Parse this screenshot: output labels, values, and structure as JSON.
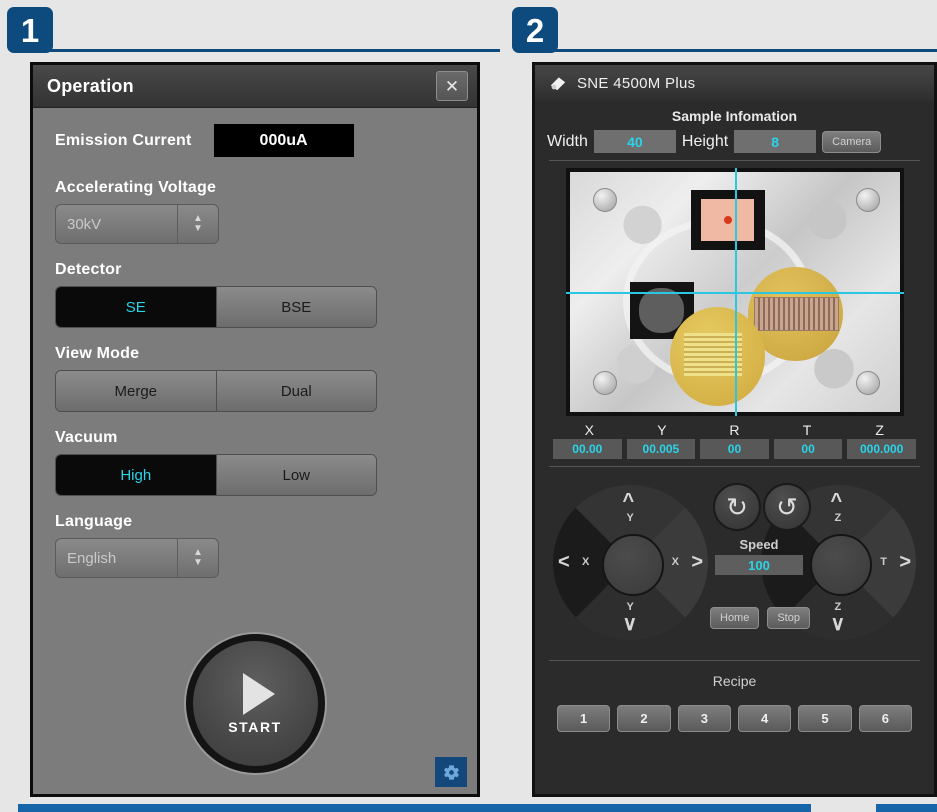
{
  "badges": {
    "one": "1",
    "two": "2"
  },
  "panel1": {
    "title": "Operation",
    "close_icon": "close-icon",
    "emission": {
      "label": "Emission Current",
      "value": "000uA"
    },
    "accelerating": {
      "label": "Accelerating Voltage",
      "value": "30kV"
    },
    "detector": {
      "label": "Detector",
      "options": [
        "SE",
        "BSE"
      ],
      "selected": "SE"
    },
    "view_mode": {
      "label": "View Mode",
      "options": [
        "Merge",
        "Dual"
      ],
      "selected": ""
    },
    "vacuum": {
      "label": "Vacuum",
      "options": [
        "High",
        "Low"
      ],
      "selected": "High"
    },
    "language": {
      "label": "Language",
      "value": "English"
    },
    "start": {
      "label": "START",
      "icon": "play-icon"
    },
    "settings": {
      "icon": "gear-icon"
    },
    "accent_cyan": "#2ad4e8"
  },
  "panel2": {
    "title": "SNE 4500M Plus",
    "logo_icon": "device-logo-icon",
    "sample": {
      "heading": "Sample Infomation",
      "width_label": "Width",
      "width_value": "40",
      "height_label": "Height",
      "height_value": "8",
      "camera_button": "Camera"
    },
    "stage": {
      "crosshair_color": "#29c8e0",
      "marker_color": "#d63b1c"
    },
    "coords": {
      "headers": [
        "X",
        "Y",
        "R",
        "T",
        "Z"
      ],
      "values": [
        "00.00",
        "00.005",
        "00",
        "00",
        "000.000"
      ]
    },
    "jog": {
      "left_pad": {
        "up": "Y",
        "down": "Y",
        "left": "X",
        "right": "X"
      },
      "right_pad": {
        "up": "Z",
        "down": "Z",
        "left": "T",
        "right": "T"
      },
      "rotate_cw_icon": "rotate-cw-icon",
      "rotate_ccw_icon": "rotate-ccw-icon",
      "speed_label": "Speed",
      "speed_value": "100",
      "home_button": "Home",
      "stop_button": "Stop"
    },
    "recipe": {
      "heading": "Recipe",
      "buttons": [
        "1",
        "2",
        "3",
        "4",
        "5",
        "6"
      ]
    },
    "accent_cyan": "#2ad4e8"
  }
}
